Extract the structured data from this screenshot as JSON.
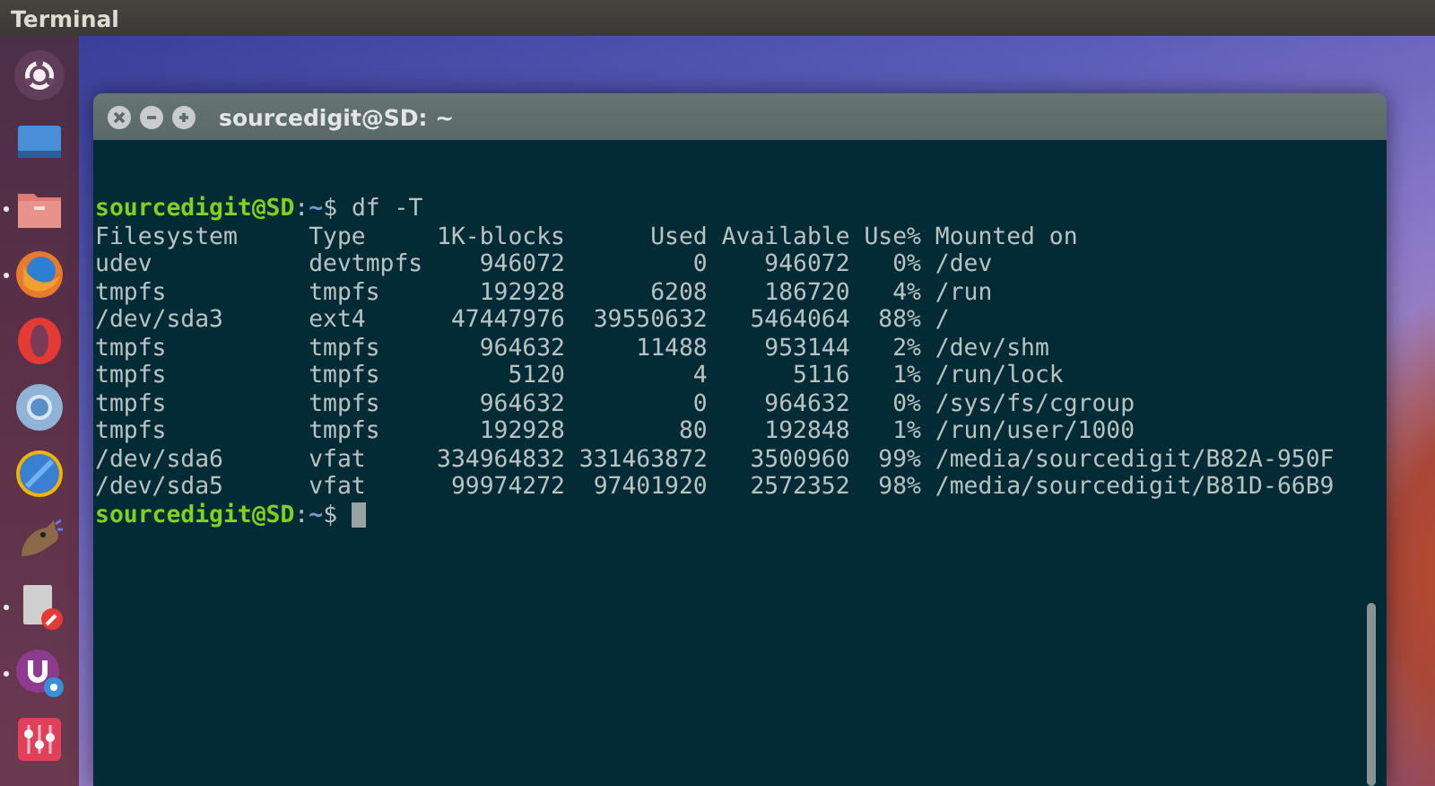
{
  "top_bar": {
    "title": "Terminal"
  },
  "launcher": {
    "items": [
      {
        "kind": "ubuntu",
        "running": false
      },
      {
        "kind": "desktop",
        "running": false
      },
      {
        "kind": "files",
        "running": true
      },
      {
        "kind": "firefox",
        "running": true
      },
      {
        "kind": "opera",
        "running": false
      },
      {
        "kind": "chromium",
        "running": false
      },
      {
        "kind": "browser",
        "running": false
      },
      {
        "kind": "gimp",
        "running": false
      },
      {
        "kind": "editor",
        "running": true
      },
      {
        "kind": "software",
        "running": true
      },
      {
        "kind": "mixer",
        "running": false
      }
    ]
  },
  "window": {
    "title": "sourcedigit@SD: ~",
    "command_prompt": {
      "user_host": "sourcedigit@SD",
      "separator": ":",
      "path": "~",
      "symbol": "$",
      "command": "df -T"
    },
    "table": {
      "columns": [
        "Filesystem",
        "Type",
        "1K-blocks",
        "Used",
        "Available",
        "Use%",
        "Mounted on"
      ],
      "rows": [
        [
          "udev",
          "devtmpfs",
          "946072",
          "0",
          "946072",
          "0%",
          "/dev"
        ],
        [
          "tmpfs",
          "tmpfs",
          "192928",
          "6208",
          "186720",
          "4%",
          "/run"
        ],
        [
          "/dev/sda3",
          "ext4",
          "47447976",
          "39550632",
          "5464064",
          "88%",
          "/"
        ],
        [
          "tmpfs",
          "tmpfs",
          "964632",
          "11488",
          "953144",
          "2%",
          "/dev/shm"
        ],
        [
          "tmpfs",
          "tmpfs",
          "5120",
          "4",
          "5116",
          "1%",
          "/run/lock"
        ],
        [
          "tmpfs",
          "tmpfs",
          "964632",
          "0",
          "964632",
          "0%",
          "/sys/fs/cgroup"
        ],
        [
          "tmpfs",
          "tmpfs",
          "192928",
          "80",
          "192848",
          "1%",
          "/run/user/1000"
        ],
        [
          "/dev/sda6",
          "vfat",
          "334964832",
          "331463872",
          "3500960",
          "99%",
          "/media/sourcedigit/B82A-950F"
        ],
        [
          "/dev/sda5",
          "vfat",
          "99974272",
          "97401920",
          "2572352",
          "98%",
          "/media/sourcedigit/B81D-66B9"
        ]
      ]
    },
    "final_prompt": {
      "user_host": "sourcedigit@SD",
      "separator": ":",
      "path": "~",
      "symbol": "$"
    }
  }
}
